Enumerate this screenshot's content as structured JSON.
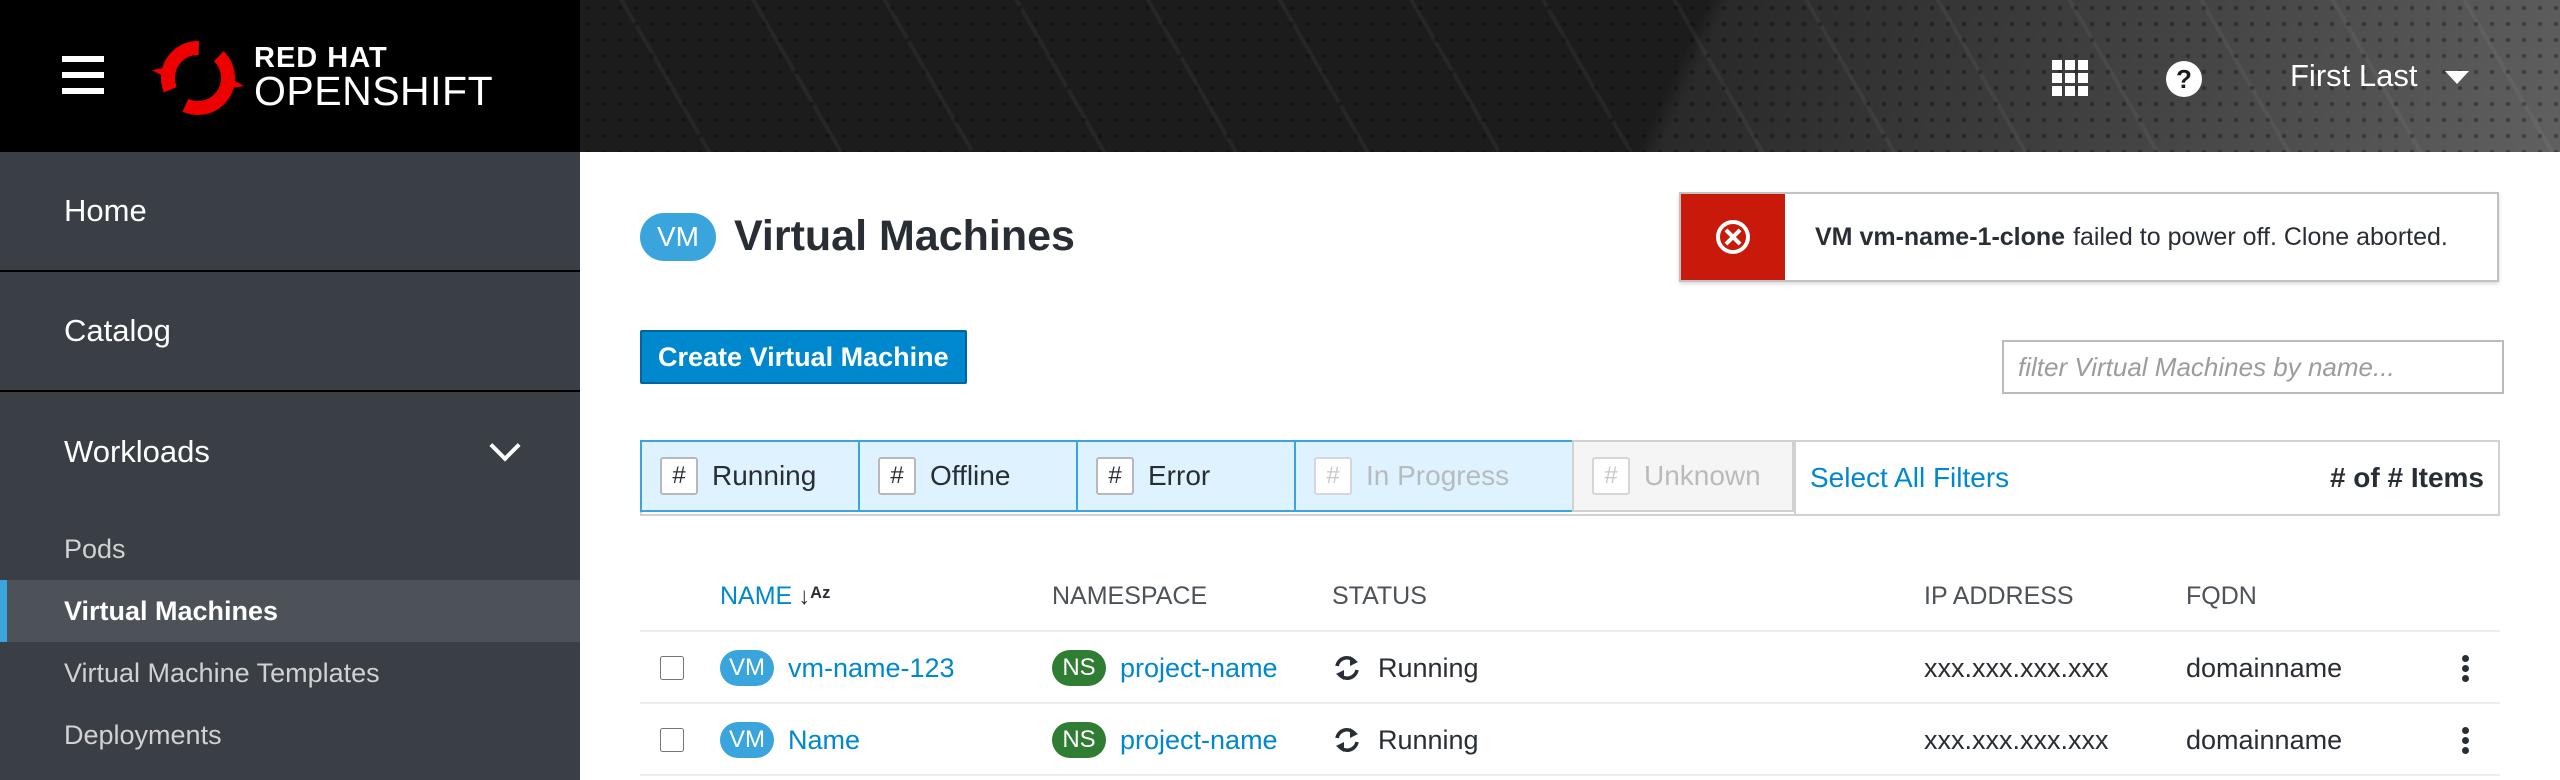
{
  "masthead": {
    "brand_top": "RED HAT",
    "brand_bottom": "OPENSHIFT",
    "user_name": "First Last",
    "icons": {
      "menu": "hamburger-icon",
      "apps": "grid-icon",
      "help": "question-circle-icon",
      "user_caret": "caret-down-icon"
    }
  },
  "sidebar": {
    "home": "Home",
    "catalog": "Catalog",
    "workloads": "Workloads",
    "items": [
      {
        "label": "Pods"
      },
      {
        "label": "Virtual Machines"
      },
      {
        "label": "Virtual Machine Templates"
      },
      {
        "label": "Deployments"
      }
    ]
  },
  "page": {
    "badge": "VM",
    "title": "Virtual Machines",
    "create_button": "Create Virtual Machine",
    "filter_placeholder": "filter Virtual Machines by name..."
  },
  "alert": {
    "bold": "VM vm-name-1-clone",
    "text": "failed to power off. Clone aborted.",
    "color": "#c9190b"
  },
  "filters": {
    "buttons": [
      {
        "count": "#",
        "label": "Running"
      },
      {
        "count": "#",
        "label": "Offline"
      },
      {
        "count": "#",
        "label": "Error"
      },
      {
        "count": "#",
        "label": "In Progress"
      },
      {
        "count": "#",
        "label": "Unknown"
      }
    ],
    "select_all": "Select All Filters",
    "item_count": "# of # Items"
  },
  "table": {
    "columns": [
      "NAME",
      "NAMESPACE",
      "STATUS",
      "IP ADDRESS",
      "FQDN"
    ],
    "rows": [
      {
        "vm_badge": "VM",
        "name": "vm-name-123",
        "ns_badge": "NS",
        "namespace": "project-name",
        "status": "Running",
        "ip": "xxx.xxx.xxx.xxx",
        "fqdn": "domainname"
      },
      {
        "vm_badge": "VM",
        "name": "Name",
        "ns_badge": "NS",
        "namespace": "project-name",
        "status": "Running",
        "ip": "xxx.xxx.xxx.xxx",
        "fqdn": "domainname"
      }
    ]
  },
  "colors": {
    "accent": "#0088ce",
    "vm_badge": "#39a5dc",
    "ns_badge": "#2e7d32",
    "sidebar": "#393f44"
  }
}
